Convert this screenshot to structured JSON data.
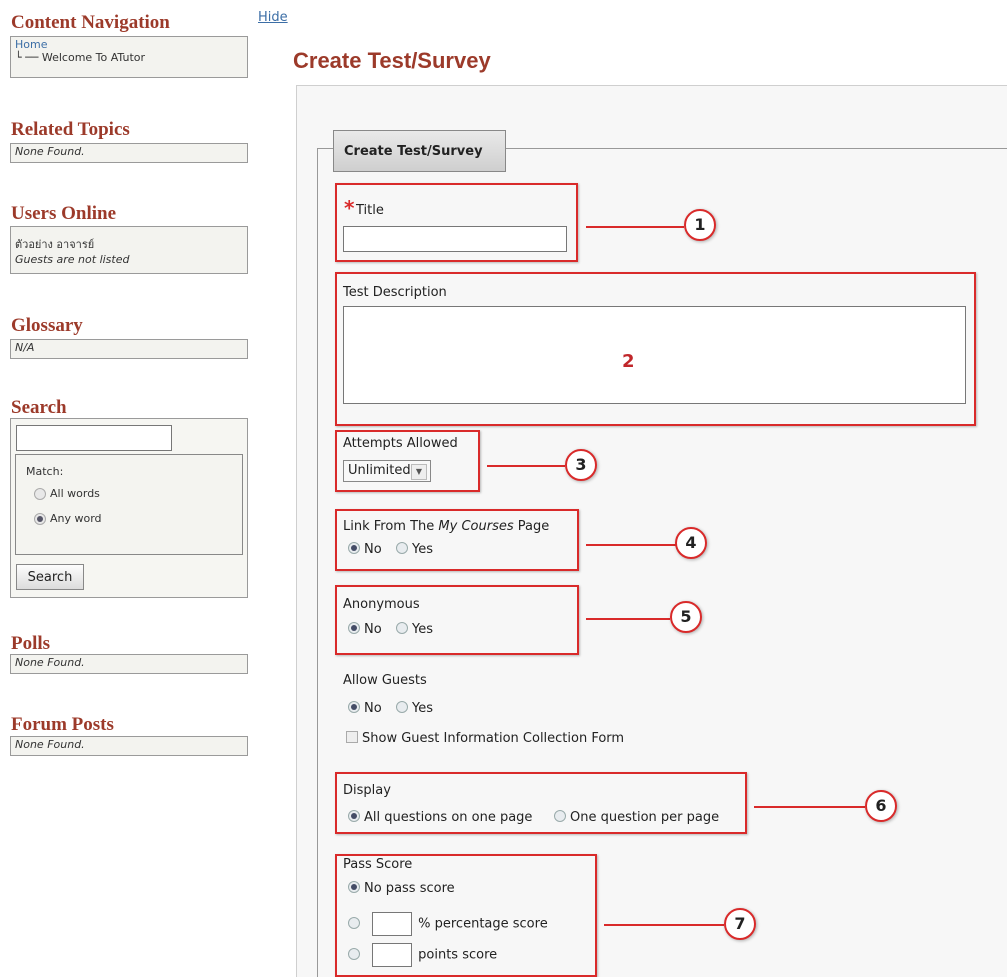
{
  "sidebar": {
    "hide_label": "Hide",
    "content_nav": {
      "heading": "Content Navigation",
      "home": "Home",
      "child": "└ ── Welcome To ATutor"
    },
    "related": {
      "heading": "Related Topics",
      "value": "None Found."
    },
    "users_online": {
      "heading": "Users Online",
      "user": "ตัวอย่าง อาจารย์",
      "note": "Guests are not listed"
    },
    "glossary": {
      "heading": "Glossary",
      "value": "N/A"
    },
    "search": {
      "heading": "Search",
      "match_label": "Match:",
      "options": [
        "All words",
        "Any word"
      ],
      "selected": "Any word",
      "button": "Search"
    },
    "polls": {
      "heading": "Polls",
      "value": "None Found."
    },
    "forum": {
      "heading": "Forum Posts",
      "value": "None Found."
    }
  },
  "main": {
    "title": "Create Test/Survey",
    "legend": "Create Test/Survey",
    "title_field": {
      "label": "Title",
      "required_mark": "*"
    },
    "description": {
      "label": "Test Description"
    },
    "attempts": {
      "label": "Attempts Allowed",
      "value": "Unlimited"
    },
    "link_from": {
      "label_pre": "Link From The ",
      "label_em": "My Courses",
      "label_post": " Page",
      "options": [
        "No",
        "Yes"
      ],
      "selected": "No"
    },
    "anonymous": {
      "label": "Anonymous",
      "options": [
        "No",
        "Yes"
      ],
      "selected": "No"
    },
    "allow_guests": {
      "label": "Allow Guests",
      "options": [
        "No",
        "Yes"
      ],
      "selected": "No",
      "checkbox": "Show Guest Information Collection Form"
    },
    "display": {
      "label": "Display",
      "options": [
        "All questions on one page",
        "One question per page"
      ],
      "selected": "All questions on one page"
    },
    "pass_score": {
      "label": "Pass Score",
      "options": [
        "No pass score",
        "% percentage score",
        "points score"
      ],
      "selected": "No pass score"
    }
  },
  "annotations": {
    "numbers": [
      "1",
      "2",
      "3",
      "4",
      "5",
      "6",
      "7"
    ],
    "color": "#d92a2a"
  },
  "colors": {
    "heading": "#9c3a2a",
    "link": "#3c6ea6"
  }
}
